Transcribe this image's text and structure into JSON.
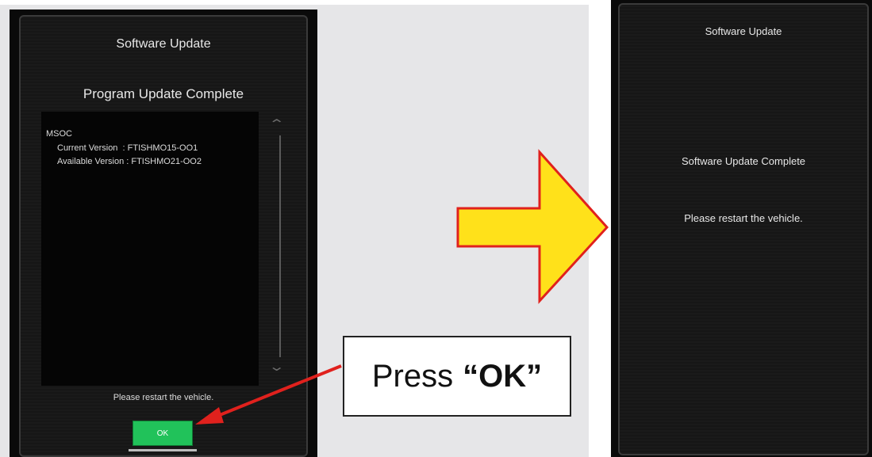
{
  "left_screen": {
    "title": "Software Update",
    "subtitle": "Program Update Complete",
    "module": "MSOC",
    "current_version": "Current Version  : FTISHMO15-OO1",
    "available_version": "Available Version : FTISHMO21-OO2",
    "footer": "Please restart the vehicle.",
    "ok_label": "OK"
  },
  "callout": {
    "prefix": "Press",
    "emphasis": "“OK”"
  },
  "right_screen": {
    "title": "Software Update",
    "message": "Software Update Complete",
    "instruction": "Please restart the vehicle."
  },
  "colors": {
    "arrow_fill": "#ffe11a",
    "arrow_stroke": "#e0211d",
    "pointer": "#e0211d",
    "ok_button": "#21c25a"
  }
}
